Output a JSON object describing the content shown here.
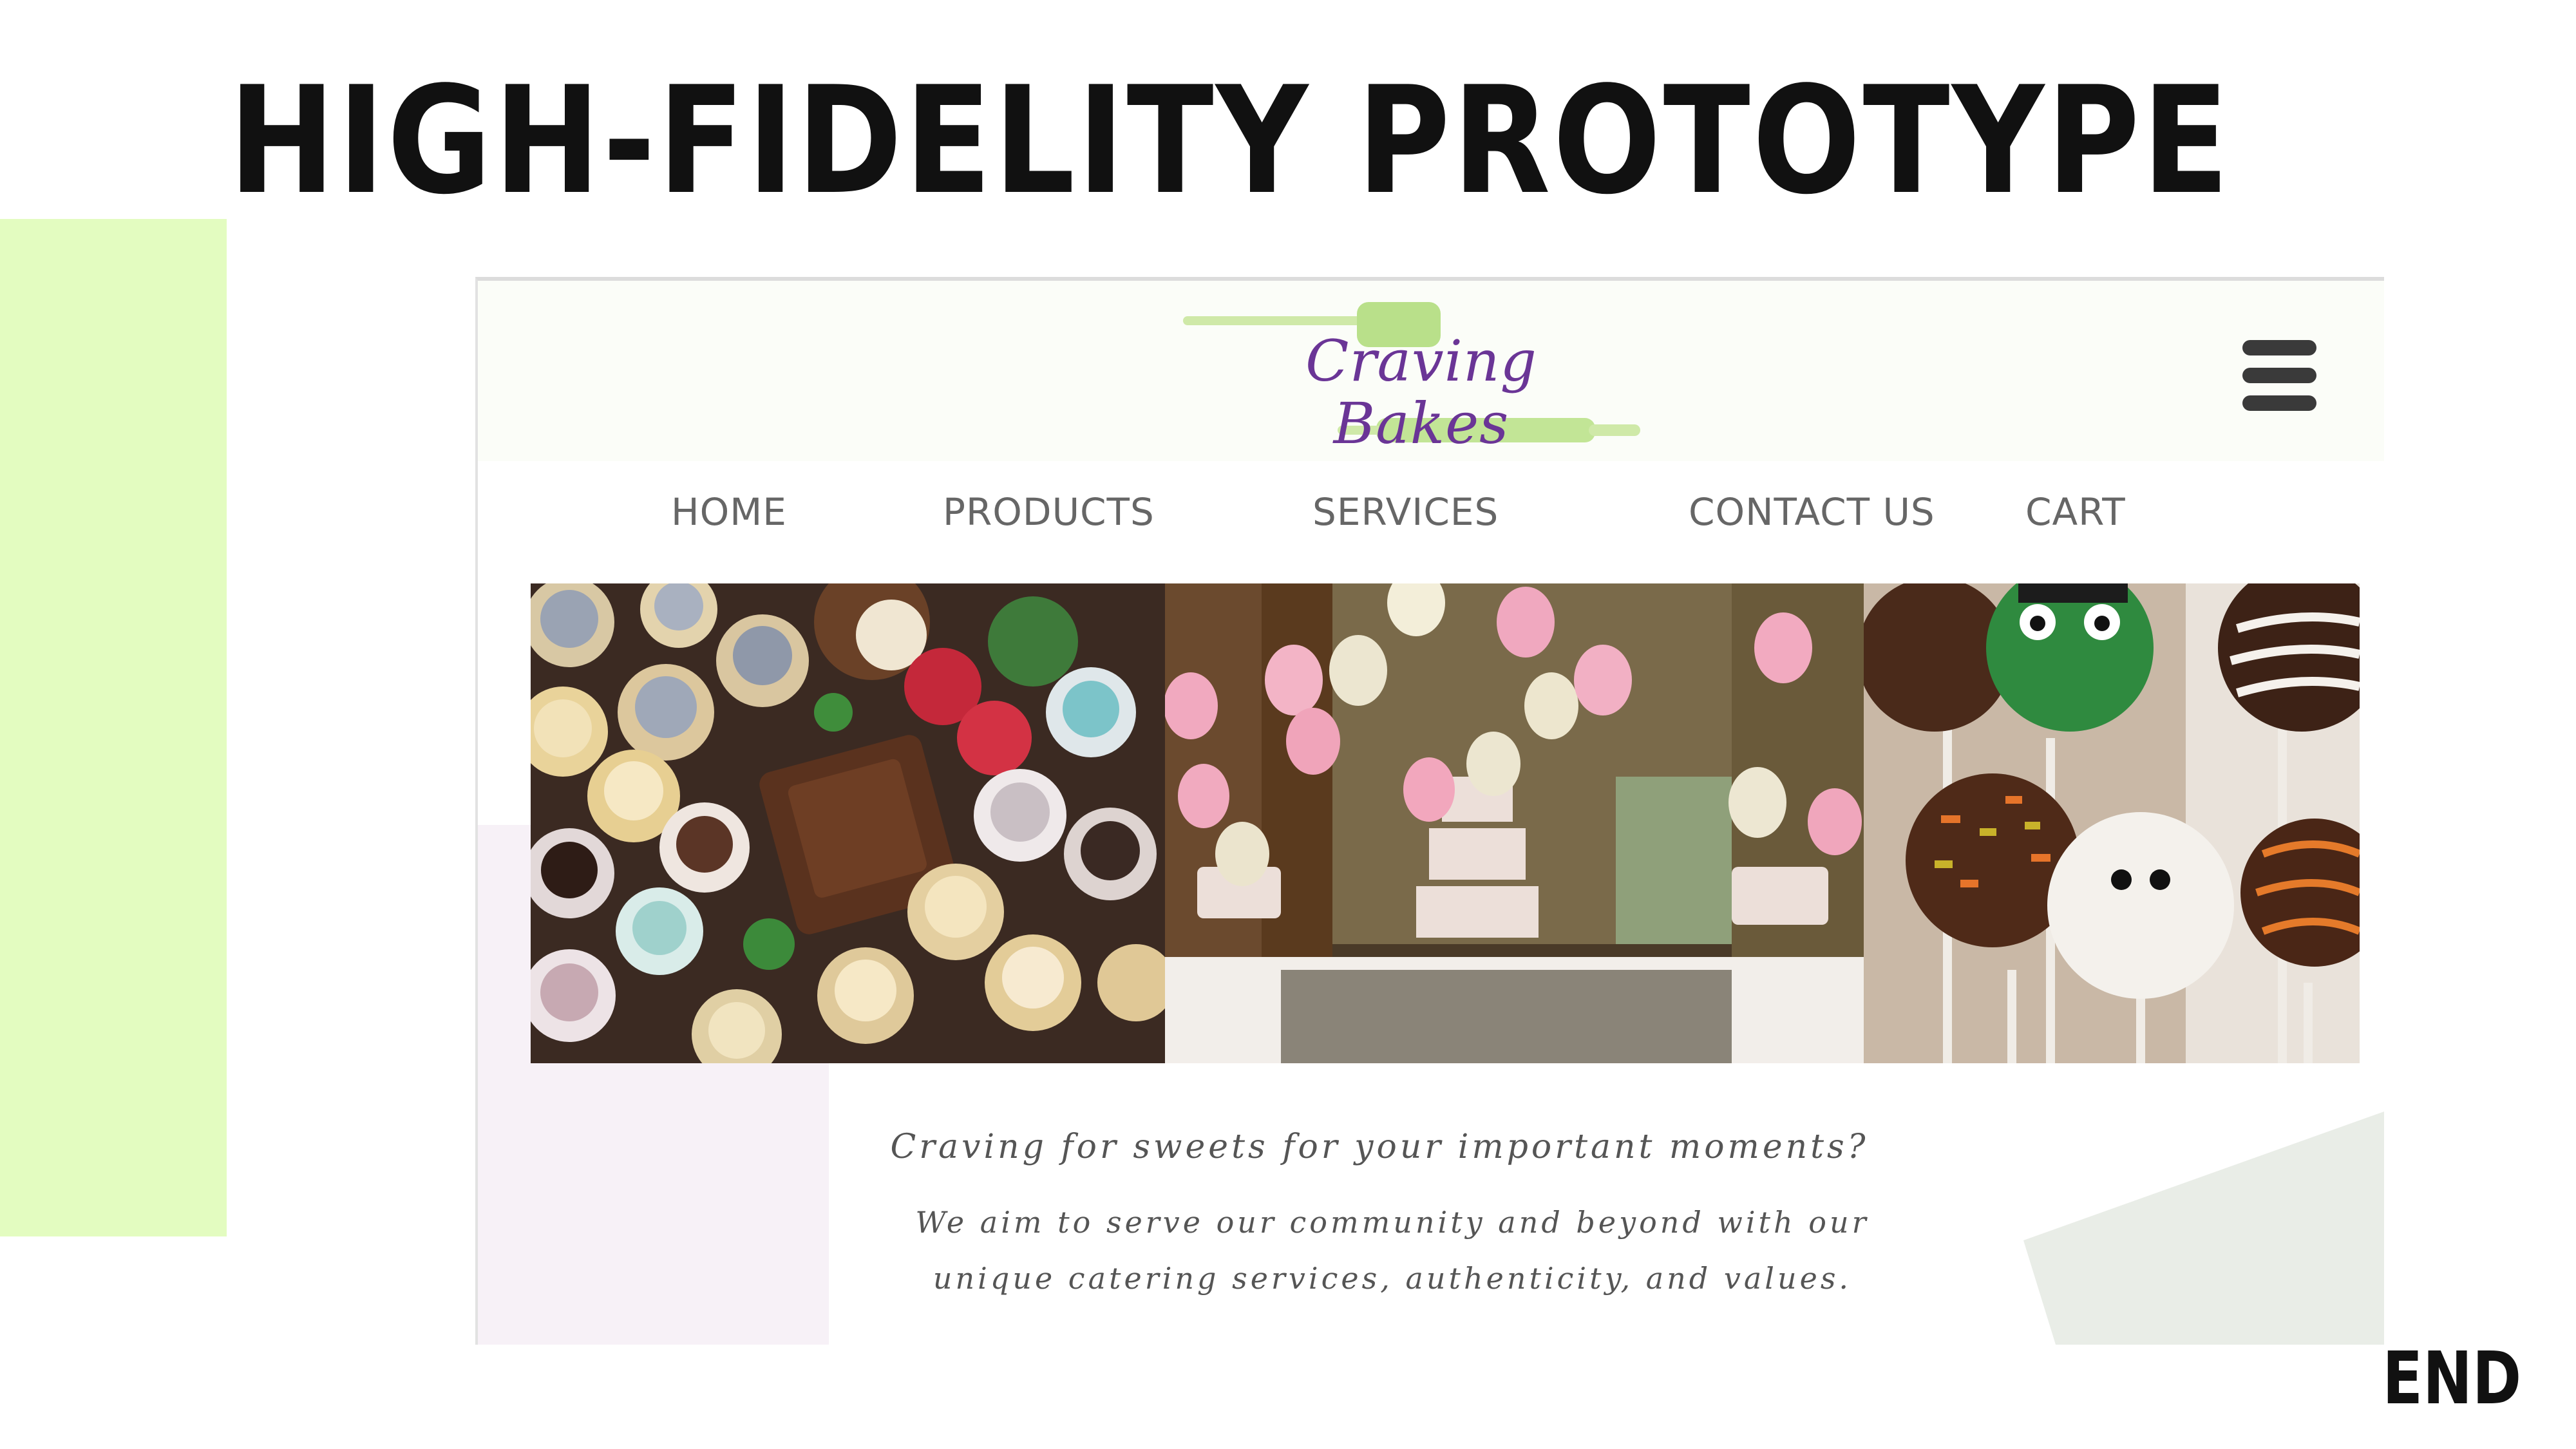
{
  "slide": {
    "title": "HIGH-FIDELITY PROTOTYPE",
    "end_label": "END"
  },
  "site": {
    "logo_text": "Craving Bakes",
    "nav": [
      "HOME",
      "PRODUCTS",
      "SERVICES",
      "CONTACT US",
      "CART"
    ],
    "menu_icon": "hamburger-menu-icon",
    "hero_images": [
      "assorted-desserts-photo",
      "dessert-table-balloons-photo",
      "cake-pops-photo"
    ],
    "tagline": "Craving for sweets for your important moments?",
    "description_line1": "We aim to serve our community and beyond with our",
    "description_line2": "unique catering services, authenticity, and values."
  },
  "colors": {
    "accent_green": "#e3fcc0",
    "logo_purple": "#6a3596",
    "logo_green": "#b9e08a",
    "nav_text": "#666666",
    "pink_block": "#f7f1f7",
    "gray_shape": "#e9ede7"
  }
}
